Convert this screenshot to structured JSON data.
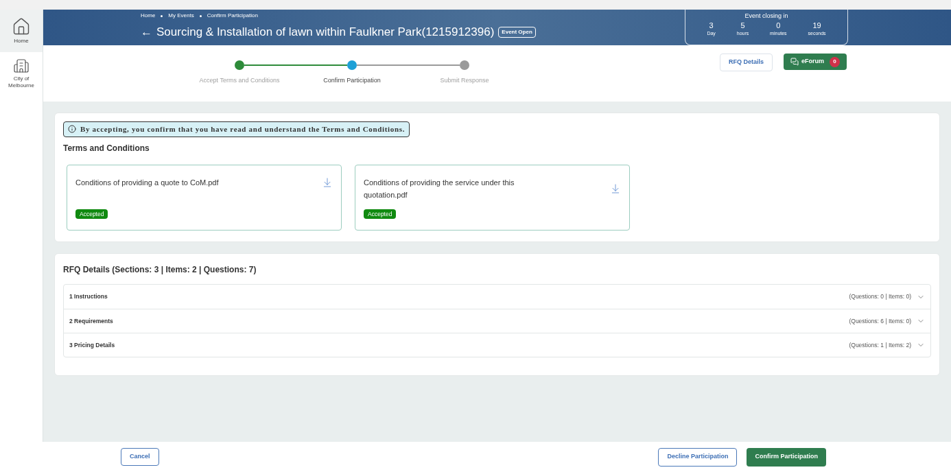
{
  "sidebar": {
    "items": [
      {
        "label": "Home",
        "kind": "home",
        "selected": true
      },
      {
        "label": "City of Melbourne",
        "kind": "building",
        "selected": false
      }
    ]
  },
  "header": {
    "breadcrumbs": [
      "Home",
      "My Events",
      "Confirm Participation"
    ],
    "back": "←",
    "title": "Sourcing & Installation of lawn within Faulkner Park(1215912396)",
    "badge": "Event Open",
    "countdown": {
      "title": "Event closing in",
      "units": [
        {
          "value": "3",
          "label": "Day"
        },
        {
          "value": "5",
          "label": "hours"
        },
        {
          "value": "0",
          "label": "minutes"
        },
        {
          "value": "19",
          "label": "seconds"
        }
      ]
    }
  },
  "stepper": [
    {
      "label": "Accept Terms and Conditions",
      "kind": "done"
    },
    {
      "label": "Confirm Participation",
      "kind": "current"
    },
    {
      "label": "Submit Response",
      "kind": "pending"
    }
  ],
  "actions": {
    "rfq_button": "RFQ Details",
    "eforum_button": "eForum",
    "eforum_count": "0"
  },
  "notice": "By accepting, you confirm that you have read and understand the Terms and Conditions.",
  "terms": {
    "title": "Terms and Conditions",
    "documents": [
      {
        "name": "Conditions of providing a quote to CoM.pdf",
        "status": "Accepted"
      },
      {
        "name": "Conditions of providing the service under this quotation.pdf",
        "status": "Accepted"
      }
    ]
  },
  "rfq": {
    "title": "RFQ Details (Sections: 3 | Items: 2 | Questions: 7)",
    "sections": [
      {
        "name": "1 Instructions",
        "summary": "(Questions: 0 | Items: 0)",
        "expanded": false
      },
      {
        "name": "2 Requirements",
        "summary": "(Questions: 6 | Items: 0)",
        "expanded": false
      },
      {
        "name": "3 Pricing Details",
        "summary": "(Questions: 1 | Items: 2)",
        "expanded": false
      }
    ]
  },
  "footer": {
    "cancel": "Cancel",
    "decline": "Decline Participation",
    "confirm": "Confirm Participation"
  }
}
